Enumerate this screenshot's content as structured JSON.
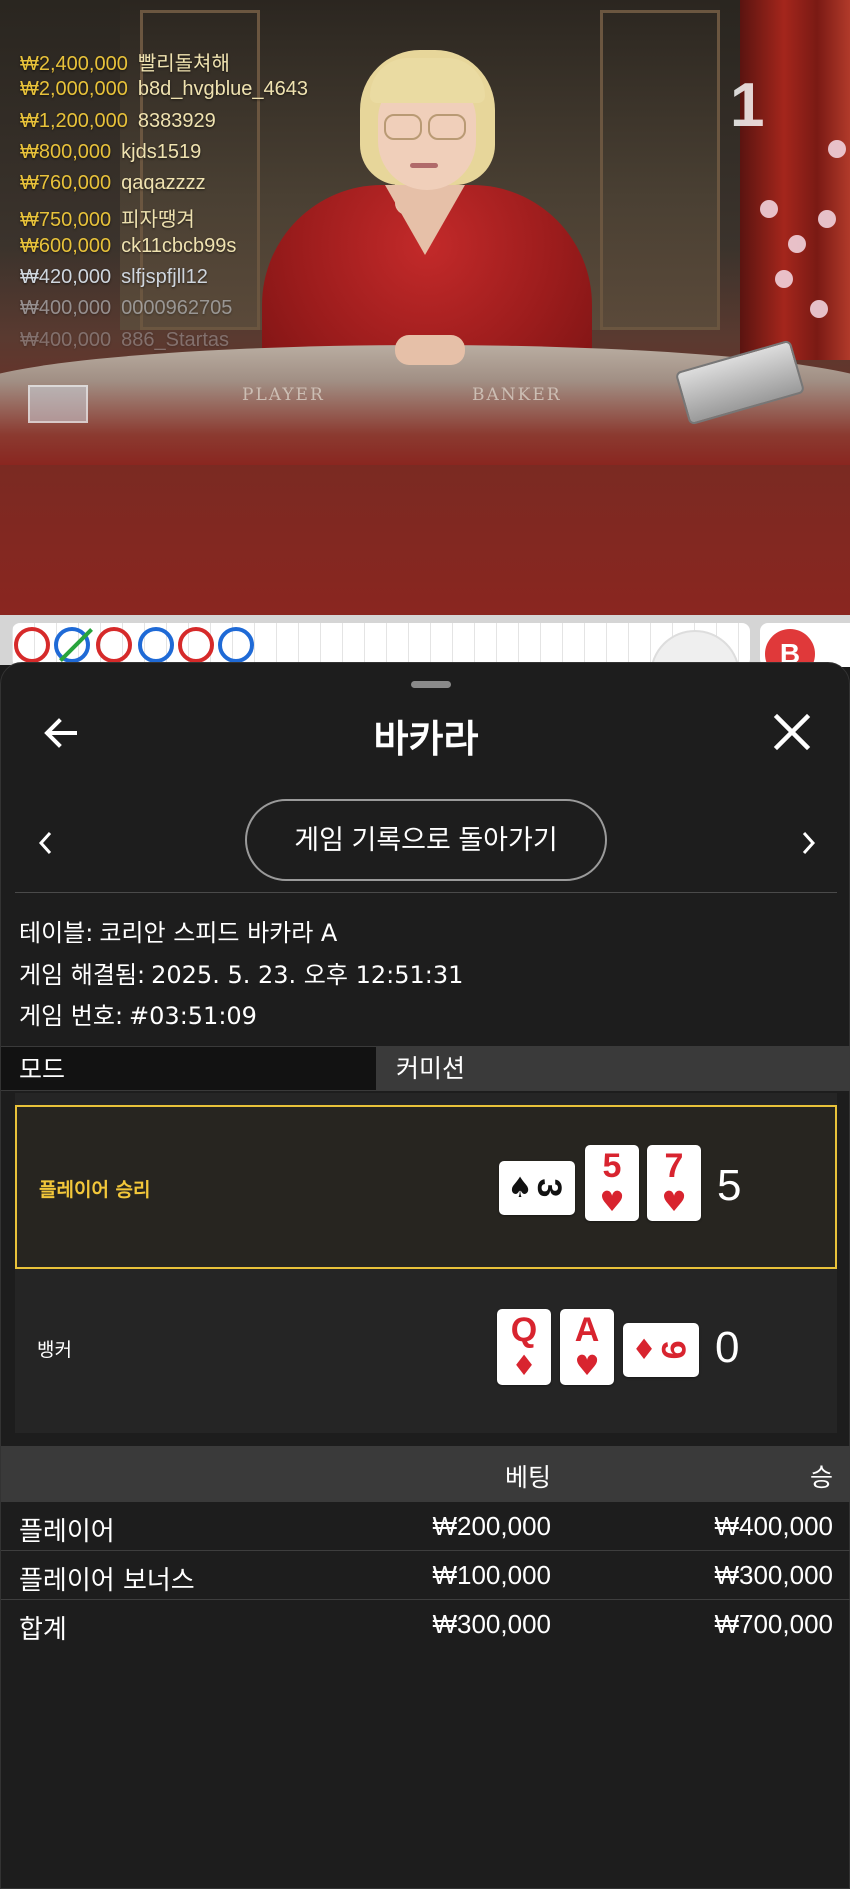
{
  "video": {
    "round_number": "1",
    "table_labels": [
      "PLAYER",
      "BANKER"
    ],
    "bet_feed": [
      {
        "amount": "₩2,400,000",
        "name": "빨리돌쳐해"
      },
      {
        "amount": "₩2,000,000",
        "name": "b8d_hvgblue_4643"
      },
      {
        "amount": "₩1,200,000",
        "name": "8383929"
      },
      {
        "amount": "₩800,000",
        "name": "kjds1519"
      },
      {
        "amount": "₩760,000",
        "name": "qaqazzzz"
      },
      {
        "amount": "₩750,000",
        "name": "피자땡겨"
      },
      {
        "amount": "₩600,000",
        "name": "ck11cbcb99s"
      },
      {
        "amount": "₩420,000",
        "name": "slfjspfjll12"
      },
      {
        "amount": "₩400,000",
        "name": "0000962705"
      },
      {
        "amount": "₩400,000",
        "name": "886_Startas"
      }
    ]
  },
  "roadmap": {
    "results": [
      "red",
      "blue",
      "red",
      "blue",
      "red",
      "blue"
    ],
    "badge": "B"
  },
  "sheet": {
    "title": "바카라",
    "back_icon": "arrow-left-icon",
    "close_icon": "close-icon",
    "back_to_history": "게임 기록으로 돌아가기",
    "table_label": "테이블:",
    "table_value": "코리안 스피드 바카라 A",
    "resolved_label": "게임 해결됨:",
    "resolved_value": "2025. 5. 23. 오후 12:51:31",
    "game_no_label": "게임 번호:",
    "game_no_value": "#03:51:09",
    "mode_header": "모드",
    "commission_header": "커미션"
  },
  "results": {
    "player": {
      "label": "플레이어 승리",
      "score": "5",
      "cards": [
        {
          "rank": "3",
          "suit": "♠",
          "color": "black",
          "sideways": true
        },
        {
          "rank": "5",
          "suit": "♥",
          "color": "red",
          "sideways": false
        },
        {
          "rank": "7",
          "suit": "♥",
          "color": "red",
          "sideways": false
        }
      ]
    },
    "banker": {
      "label": "뱅커",
      "score": "0",
      "cards": [
        {
          "rank": "Q",
          "suit": "♦",
          "color": "red",
          "sideways": false
        },
        {
          "rank": "A",
          "suit": "♥",
          "color": "red",
          "sideways": false
        },
        {
          "rank": "9",
          "suit": "♦",
          "color": "red",
          "sideways": true
        }
      ]
    }
  },
  "bets": {
    "col_bet": "베팅",
    "col_win": "승",
    "rows": [
      {
        "name": "플레이어",
        "bet": "₩200,000",
        "win": "₩400,000"
      },
      {
        "name": "플레이어 보너스",
        "bet": "₩100,000",
        "win": "₩300,000"
      }
    ],
    "total": {
      "name": "합계",
      "bet": "₩300,000",
      "win": "₩700,000"
    }
  },
  "colors": {
    "accent_gold": "#e8c23a",
    "player_win_label": "#f2c73a",
    "card_red": "#d8242f",
    "road_red": "#d62a2a",
    "road_blue": "#1f6ad6",
    "sheet_bg": "#1d1d1d"
  }
}
